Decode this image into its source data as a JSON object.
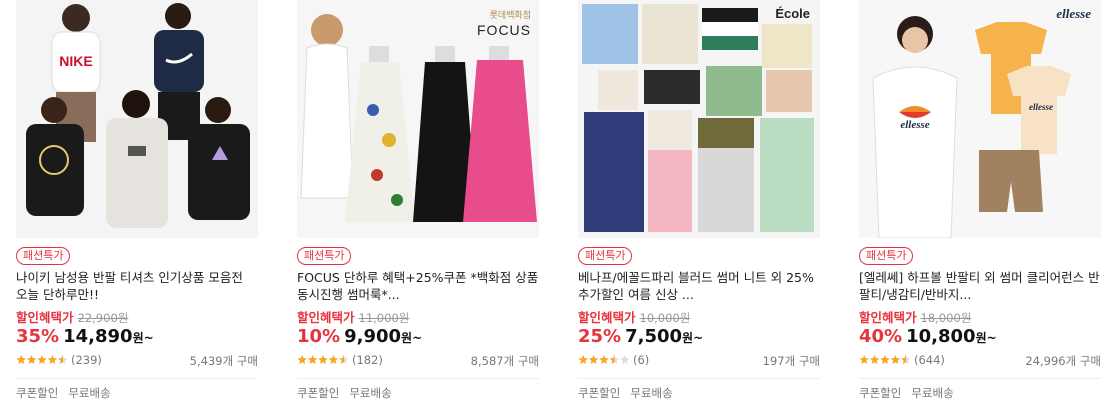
{
  "products": [
    {
      "badge": "패션특가",
      "title": "나이키 남성용 반팔 티셔츠 인기상품 모음전 오늘 단하루만!!",
      "promo_label": "할인혜택가",
      "original_price": "22,900원",
      "discount_rate": "35%",
      "price": "14,890",
      "price_unit": "원~",
      "rating": 4.5,
      "review_count": "(239)",
      "sold": "5,439개 구매",
      "tags": [
        "쿠폰할인",
        "무료배송"
      ],
      "brand_text": ""
    },
    {
      "badge": "패션특가",
      "title": "FOCUS 단하루 혜택+25%쿠폰 *백화점 상품 동시진행 썸머룩*...",
      "promo_label": "할인혜택가",
      "original_price": "11,000원",
      "discount_rate": "10%",
      "price": "9,900",
      "price_unit": "원~",
      "rating": 4.5,
      "review_count": "(182)",
      "sold": "8,587개 구매",
      "tags": [
        "쿠폰할인",
        "무료배송"
      ],
      "brand_text": "FOCUS",
      "brand_subtext": "롯데백화점"
    },
    {
      "badge": "패션특가",
      "title": "베나프/에꼴드파리 블러드 썸머 니트 외 25% 추가할인 여름 신상 ...",
      "promo_label": "할인혜택가",
      "original_price": "10,000원",
      "discount_rate": "25%",
      "price": "7,500",
      "price_unit": "원~",
      "rating": 3.5,
      "review_count": "(6)",
      "sold": "197개 구매",
      "tags": [
        "쿠폰할인",
        "무료배송"
      ],
      "brand_text": "École"
    },
    {
      "badge": "패션특가",
      "title": "[엘레쎄] 하프볼 반팔티 외 썸머 클리어런스 반팔티/냉감티/반바지...",
      "promo_label": "할인혜택가",
      "original_price": "18,000원",
      "discount_rate": "40%",
      "price": "10,800",
      "price_unit": "원~",
      "rating": 4.5,
      "review_count": "(644)",
      "sold": "24,996개 구매",
      "tags": [
        "쿠폰할인",
        "무료배송"
      ],
      "brand_text": "ellesse"
    }
  ],
  "colors": {
    "accent_red": "#e5343e",
    "star": "#f5a623",
    "muted": "#777777"
  }
}
